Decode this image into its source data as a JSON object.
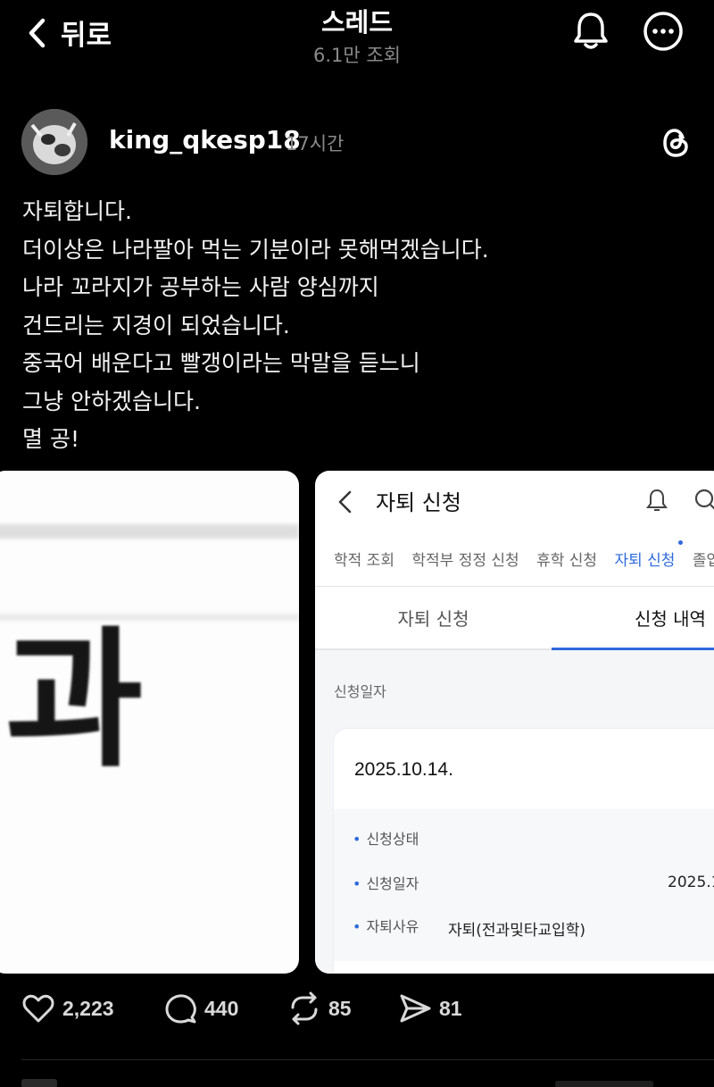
{
  "header": {
    "back_label": "뒤로",
    "title": "스레드",
    "views": "6.1만 조회"
  },
  "post": {
    "username": "king_qkesp18",
    "time": "17시간",
    "lines": [
      "자퇴합니다.",
      "더이상은 나라팔아 먹는 기분이라 못해먹겠습니다.",
      "나라 꼬라지가 공부하는 사람 양심까지",
      "건드리는 지경이 되었습니다.",
      "중국어 배운다고 빨갱이라는 막말을 듣느니",
      "그냥 안하겠습니다.",
      "멸 공!"
    ]
  },
  "image1": {
    "text": "과"
  },
  "image2": {
    "title": "자퇴 신청",
    "tabs": [
      "학적 조회",
      "학적부 정정 신청",
      "휴학 신청",
      "자퇴 신청",
      "졸업"
    ],
    "subtabs": [
      "자퇴 신청",
      "신청 내역"
    ],
    "date_label": "신청일자",
    "card_date": "2025.10.14.",
    "rows": [
      {
        "label": "신청상태",
        "value": ""
      },
      {
        "label": "신청일자",
        "value": "2025.1"
      },
      {
        "label": "자퇴사유",
        "value": "자퇴(전과및타교입학)"
      }
    ]
  },
  "actions": {
    "likes": "2,223",
    "comments": "440",
    "reposts": "85",
    "shares": "81"
  },
  "colors": {
    "background": "#000000",
    "text": "#f3f3f3",
    "muted": "#8a8a8a",
    "accent": "#2f6bdc"
  },
  "icons": [
    "chevron-left-icon",
    "bell-icon",
    "more-icon",
    "threads-logo-icon",
    "heart-icon",
    "comment-icon",
    "repost-icon",
    "send-icon",
    "search-icon"
  ]
}
